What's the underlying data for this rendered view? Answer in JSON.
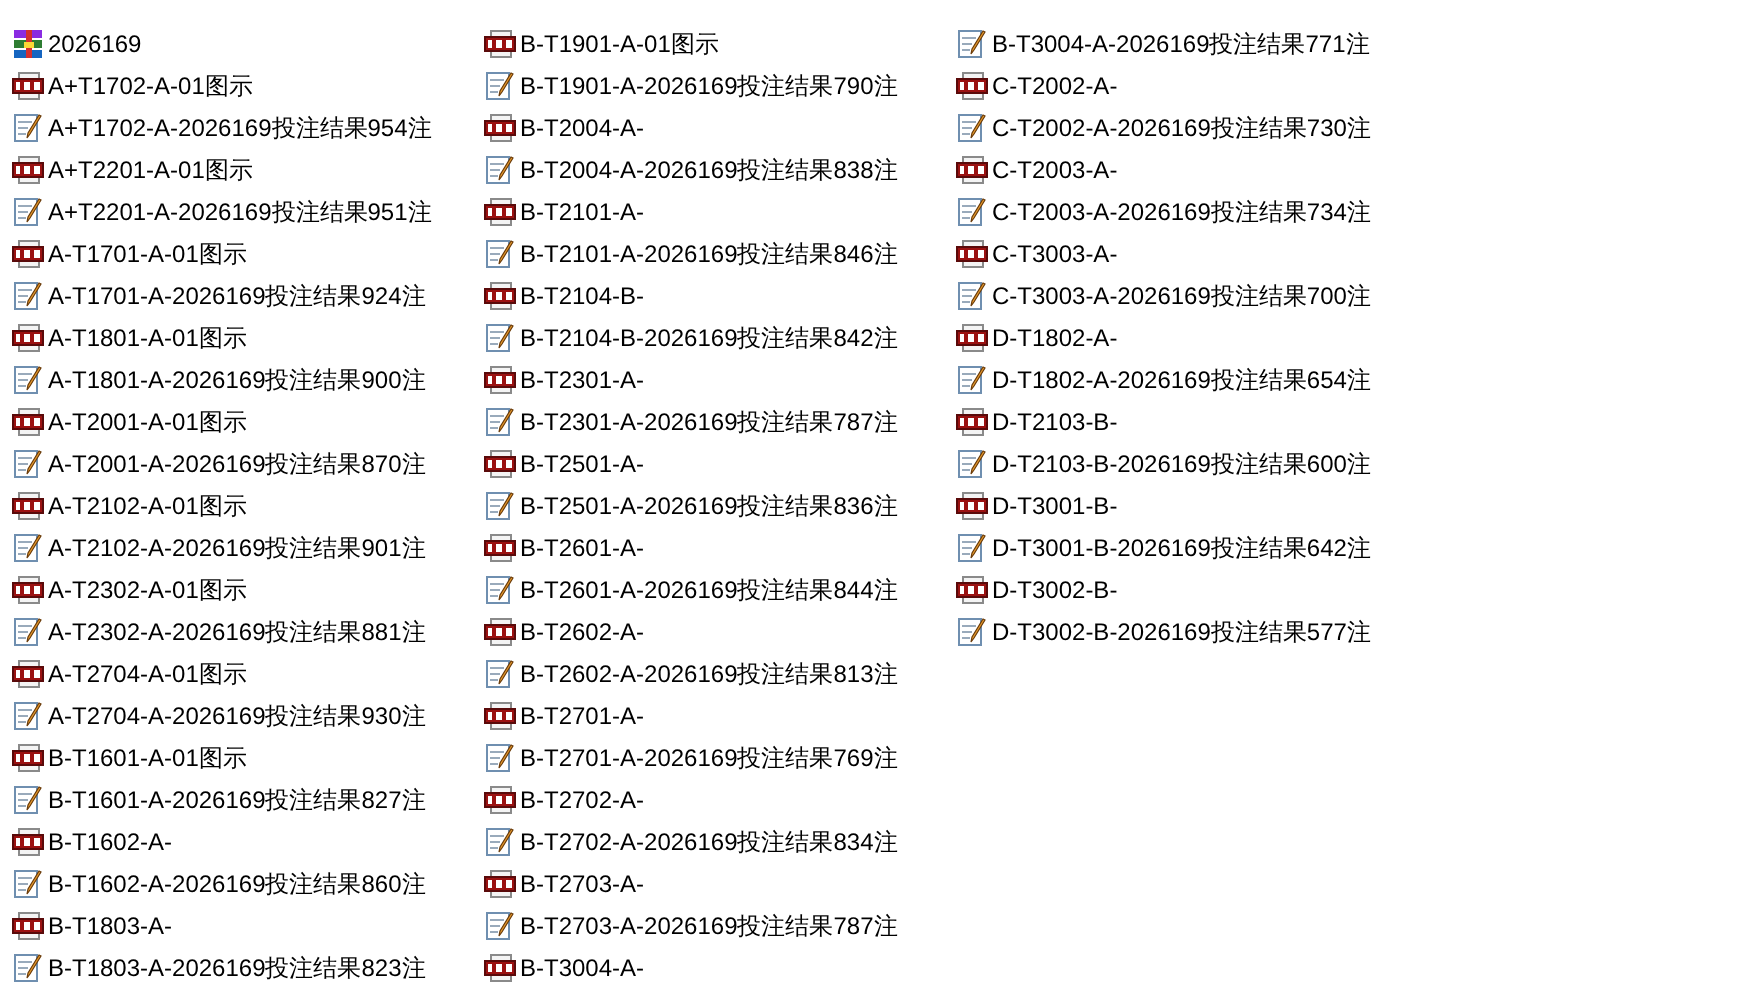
{
  "files": [
    {
      "name": "2026169",
      "kind": "archive"
    },
    {
      "name": "A+T1702-A-01图示",
      "kind": "png"
    },
    {
      "name": "A+T1702-A-2026169投注结果954注",
      "kind": "text"
    },
    {
      "name": "A+T2201-A-01图示",
      "kind": "png"
    },
    {
      "name": "A+T2201-A-2026169投注结果951注",
      "kind": "text"
    },
    {
      "name": "A-T1701-A-01图示",
      "kind": "png"
    },
    {
      "name": "A-T1701-A-2026169投注结果924注",
      "kind": "text"
    },
    {
      "name": "A-T1801-A-01图示",
      "kind": "png"
    },
    {
      "name": "A-T1801-A-2026169投注结果900注",
      "kind": "text"
    },
    {
      "name": "A-T2001-A-01图示",
      "kind": "png"
    },
    {
      "name": "A-T2001-A-2026169投注结果870注",
      "kind": "text"
    },
    {
      "name": "A-T2102-A-01图示",
      "kind": "png"
    },
    {
      "name": "A-T2102-A-2026169投注结果901注",
      "kind": "text"
    },
    {
      "name": "A-T2302-A-01图示",
      "kind": "png"
    },
    {
      "name": "A-T2302-A-2026169投注结果881注",
      "kind": "text"
    },
    {
      "name": "A-T2704-A-01图示",
      "kind": "png"
    },
    {
      "name": "A-T2704-A-2026169投注结果930注",
      "kind": "text"
    },
    {
      "name": "B-T1601-A-01图示",
      "kind": "png"
    },
    {
      "name": "B-T1601-A-2026169投注结果827注",
      "kind": "text"
    },
    {
      "name": "B-T1602-A-",
      "kind": "png"
    },
    {
      "name": "B-T1602-A-2026169投注结果860注",
      "kind": "text"
    },
    {
      "name": "B-T1803-A-",
      "kind": "png"
    },
    {
      "name": "B-T1803-A-2026169投注结果823注",
      "kind": "text"
    },
    {
      "name": "B-T1901-A-01图示",
      "kind": "png"
    },
    {
      "name": "B-T1901-A-2026169投注结果790注",
      "kind": "text"
    },
    {
      "name": "B-T2004-A-",
      "kind": "png"
    },
    {
      "name": "B-T2004-A-2026169投注结果838注",
      "kind": "text"
    },
    {
      "name": "B-T2101-A-",
      "kind": "png"
    },
    {
      "name": "B-T2101-A-2026169投注结果846注",
      "kind": "text"
    },
    {
      "name": "B-T2104-B-",
      "kind": "png"
    },
    {
      "name": "B-T2104-B-2026169投注结果842注",
      "kind": "text"
    },
    {
      "name": "B-T2301-A-",
      "kind": "png"
    },
    {
      "name": "B-T2301-A-2026169投注结果787注",
      "kind": "text"
    },
    {
      "name": "B-T2501-A-",
      "kind": "png"
    },
    {
      "name": "B-T2501-A-2026169投注结果836注",
      "kind": "text"
    },
    {
      "name": "B-T2601-A-",
      "kind": "png"
    },
    {
      "name": "B-T2601-A-2026169投注结果844注",
      "kind": "text"
    },
    {
      "name": "B-T2602-A-",
      "kind": "png"
    },
    {
      "name": "B-T2602-A-2026169投注结果813注",
      "kind": "text"
    },
    {
      "name": "B-T2701-A-",
      "kind": "png"
    },
    {
      "name": "B-T2701-A-2026169投注结果769注",
      "kind": "text"
    },
    {
      "name": "B-T2702-A-",
      "kind": "png"
    },
    {
      "name": "B-T2702-A-2026169投注结果834注",
      "kind": "text"
    },
    {
      "name": "B-T2703-A-",
      "kind": "png"
    },
    {
      "name": "B-T2703-A-2026169投注结果787注",
      "kind": "text"
    },
    {
      "name": "B-T3004-A-",
      "kind": "png"
    },
    {
      "name": "B-T3004-A-2026169投注结果771注",
      "kind": "text"
    },
    {
      "name": "C-T2002-A-",
      "kind": "png"
    },
    {
      "name": "C-T2002-A-2026169投注结果730注",
      "kind": "text"
    },
    {
      "name": "C-T2003-A-",
      "kind": "png"
    },
    {
      "name": "C-T2003-A-2026169投注结果734注",
      "kind": "text"
    },
    {
      "name": "C-T3003-A-",
      "kind": "png"
    },
    {
      "name": "C-T3003-A-2026169投注结果700注",
      "kind": "text"
    },
    {
      "name": "D-T1802-A-",
      "kind": "png"
    },
    {
      "name": "D-T1802-A-2026169投注结果654注",
      "kind": "text"
    },
    {
      "name": "D-T2103-B-",
      "kind": "png"
    },
    {
      "name": "D-T2103-B-2026169投注结果600注",
      "kind": "text"
    },
    {
      "name": "D-T3001-B-",
      "kind": "png"
    },
    {
      "name": "D-T3001-B-2026169投注结果642注",
      "kind": "text"
    },
    {
      "name": "D-T3002-B-",
      "kind": "png"
    },
    {
      "name": "D-T3002-B-2026169投注结果577注",
      "kind": "text"
    }
  ]
}
